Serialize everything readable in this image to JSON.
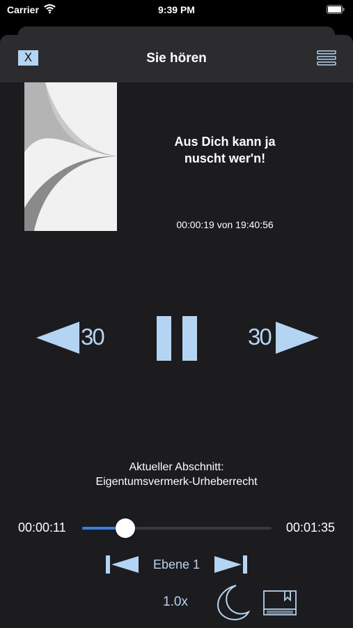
{
  "status_bar": {
    "carrier": "Carrier",
    "time": "9:39 PM"
  },
  "nav": {
    "close_label": "X",
    "title": "Sie hören"
  },
  "track": {
    "title": "Aus Dich kann ja nuscht wer'n!",
    "position": "00:00:19 von 19:40:56"
  },
  "controls": {
    "rewind_seconds": "30",
    "forward_seconds": "30"
  },
  "section": {
    "label": "Aktueller Abschnitt:",
    "name": "Eigentumsvermerk-Urheberrecht"
  },
  "progress": {
    "current": "00:00:11",
    "total": "00:01:35",
    "fraction": 0.116
  },
  "level": {
    "label": "Ebene 1"
  },
  "footer": {
    "speed": "1.0x"
  },
  "colors": {
    "accent": "#b3d4f2",
    "slider_fill": "#3b7fe0",
    "background": "#1c1c1e",
    "nav_bar": "#2c2c2e"
  },
  "icons": {
    "close": "close-icon",
    "menu": "menu-icon",
    "rewind": "rewind-icon",
    "pause": "pause-icon",
    "forward": "forward-icon",
    "previous_level": "previous-level-icon",
    "next_level": "next-level-icon",
    "sleep_timer": "moon-icon",
    "bookmarks": "bookmark-book-icon"
  }
}
